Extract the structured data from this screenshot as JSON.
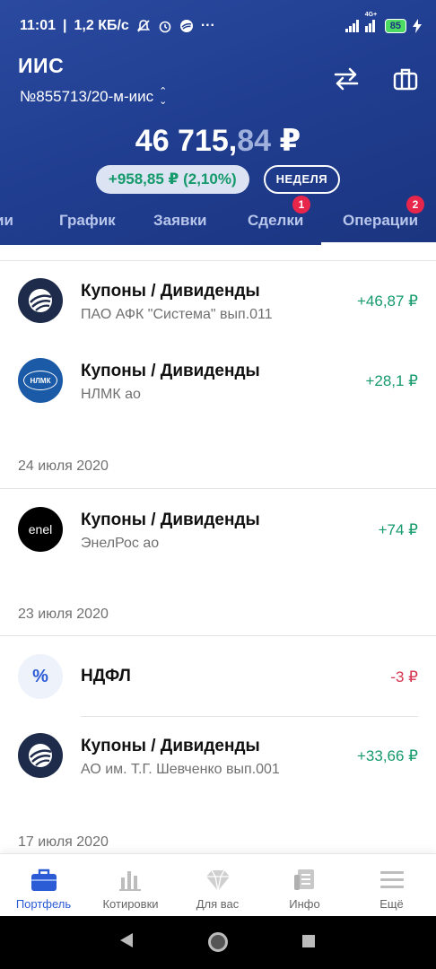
{
  "status_bar": {
    "time": "11:01",
    "speed": "1,2 КБ/с",
    "network_label": "4G+",
    "battery": "85"
  },
  "header": {
    "title": "ИИС",
    "account_number": "№855713/20-м-иис",
    "balance_int": "46 715,",
    "balance_dec": "84",
    "balance_currency": " ₽",
    "change": "+958,85 ₽ (2,10%)",
    "period": "НЕДЕЛЯ"
  },
  "tabs": [
    {
      "label": "ии"
    },
    {
      "label": "График"
    },
    {
      "label": "Заявки"
    },
    {
      "label": "Сделки",
      "badge": "1"
    },
    {
      "label": "Операции",
      "badge": "2"
    }
  ],
  "operations": [
    {
      "title": "Купоны / Дивиденды",
      "subtitle": "ПАО АФК \"Система\" вып.011",
      "amount": "+46,87 ₽",
      "logo": "afk-sistema-logo"
    },
    {
      "title": "Купоны / Дивиденды",
      "subtitle": "НЛМК ао",
      "amount": "+28,1 ₽",
      "logo": "nlmk-logo",
      "logo_text": "НЛМК"
    },
    {
      "date": "24 июля 2020"
    },
    {
      "title": "Купоны / Дивиденды",
      "subtitle": "ЭнелРос ао",
      "amount": "+74 ₽",
      "logo": "enel-logo",
      "logo_text": "enel"
    },
    {
      "date": "23 июля 2020"
    },
    {
      "title": "НДФЛ",
      "amount": "-3 ₽",
      "logo": "percent-icon",
      "logo_text": "%"
    },
    {
      "title": "Купоны / Дивиденды",
      "subtitle": "АО им. Т.Г. Шевченко вып.001",
      "amount": "+33,66 ₽",
      "logo": "shevchenko-logo"
    },
    {
      "date": "17 июля 2020"
    }
  ],
  "bottom_nav": [
    {
      "label": "Портфель",
      "icon": "briefcase-icon",
      "active": true
    },
    {
      "label": "Котировки",
      "icon": "bar-chart-icon"
    },
    {
      "label": "Для вас",
      "icon": "diamond-icon"
    },
    {
      "label": "Инфо",
      "icon": "news-icon"
    },
    {
      "label": "Ещё",
      "icon": "menu-icon"
    }
  ],
  "colors": {
    "header_bg": "#1f3c8e",
    "positive": "#159a6b",
    "negative": "#d6344f",
    "accent": "#2c5bd6",
    "badge": "#e8254b"
  }
}
